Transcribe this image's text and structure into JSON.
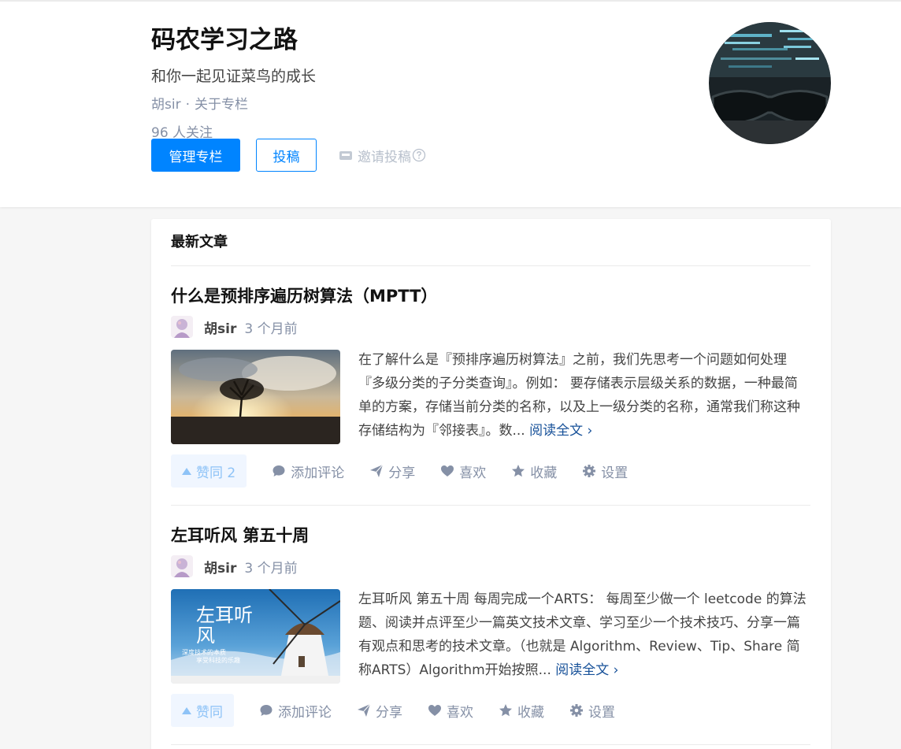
{
  "column": {
    "title": "码农学习之路",
    "description": "和你一起见证菜鸟的成长",
    "owner": "胡sir",
    "meta_sep": "·",
    "about": "关于专栏",
    "followers": "96 人关注",
    "manage_label": "管理专栏",
    "submit_label": "投稿",
    "invite_label": "邀请投稿"
  },
  "feed": {
    "heading": "最新文章",
    "articles": [
      {
        "title": "什么是预排序遍历树算法（MPTT）",
        "author": "胡sir",
        "time": "3 个月前",
        "excerpt": "在了解什么是『预排序遍历树算法』之前，我们先思考一个问题如何处理『多级分类的子分类查询』。例如： 要存储表示层级关系的数据，一种最简单的方案，存储当前分类的名称，以及上一级分类的名称，通常我们称这种存储结构为『邻接表』。数...",
        "read_more": "阅读全文 ›",
        "vote_label": "赞同 2",
        "comment_label": "添加评论",
        "share_label": "分享",
        "like_label": "喜欢",
        "collect_label": "收藏",
        "settings_label": "设置"
      },
      {
        "title": "左耳听风 第五十周",
        "author": "胡sir",
        "time": "3 个月前",
        "excerpt": "左耳听风 第五十周 每周完成一个ARTS： 每周至少做一个 leetcode 的算法题、阅读并点评至少一篇英文技术文章、学习至少一个技术技巧、分享一篇有观点和思考的技术文章。（也就是 Algorithm、Review、Tip、Share 简称ARTS）Algorithm开始按照...",
        "read_more": "阅读全文 ›",
        "thumb_text_main": "左耳听风",
        "thumb_text_sub1": "深度技术的本质",
        "thumb_text_sub2": "享受科技的乐趣",
        "vote_label": "赞同",
        "comment_label": "添加评论",
        "share_label": "分享",
        "like_label": "喜欢",
        "collect_label": "收藏",
        "settings_label": "设置"
      }
    ]
  },
  "colors": {
    "primary": "#0084ff",
    "muted": "#8590a6",
    "link": "#175199",
    "vote_bg": "#f0f6ff"
  }
}
